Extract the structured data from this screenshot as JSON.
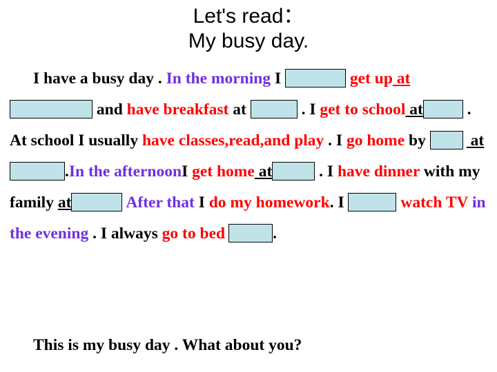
{
  "slide": {
    "title_line1": "Let's read：",
    "title_line2": "My busy day.",
    "colors": {
      "red": "#ff0000",
      "purple": "#7030e0",
      "black": "#000000",
      "box_fill": "#bfe3e8",
      "box_border": "#000000",
      "background": "#ffffff"
    },
    "passage": {
      "s1_a": "I have a busy day . ",
      "s1_b": "In the morning",
      "s1_c": " I ",
      "s1_d": " get up",
      "s1_e": " at",
      "s1_f": " and ",
      "s1_g": "have breakfast",
      "s1_h": " at ",
      "s1_i": " . I ",
      "s2_a": "get to school",
      "s2_b": " at",
      "s2_c": " . At school I usually ",
      "s2_d": "have classes,read,and play",
      "s2_e": " . I ",
      "s2_f": "go home",
      "s2_g": " by ",
      "s2_h": " at",
      "s2_i": ".",
      "s3_a": "In the afternoon",
      "s3_b": "I ",
      "s3_c": "get home",
      "s3_d": " at",
      "s3_e": " . I ",
      "s3_f": "have dinner",
      "s3_g": " with my family ",
      "s3_h": "at",
      "s3_i": " ",
      "s3_j": "After that",
      "s3_k": " I ",
      "s3_l": "do my homework",
      "s3_m": ". I ",
      "s3_n": " watch TV ",
      "s3_o": "in the evening",
      "s3_p": " . I ",
      "s4_a": "always ",
      "s4_b": "go to bed",
      "s4_c": "."
    },
    "closing": "This is my busy day . What about you?"
  }
}
